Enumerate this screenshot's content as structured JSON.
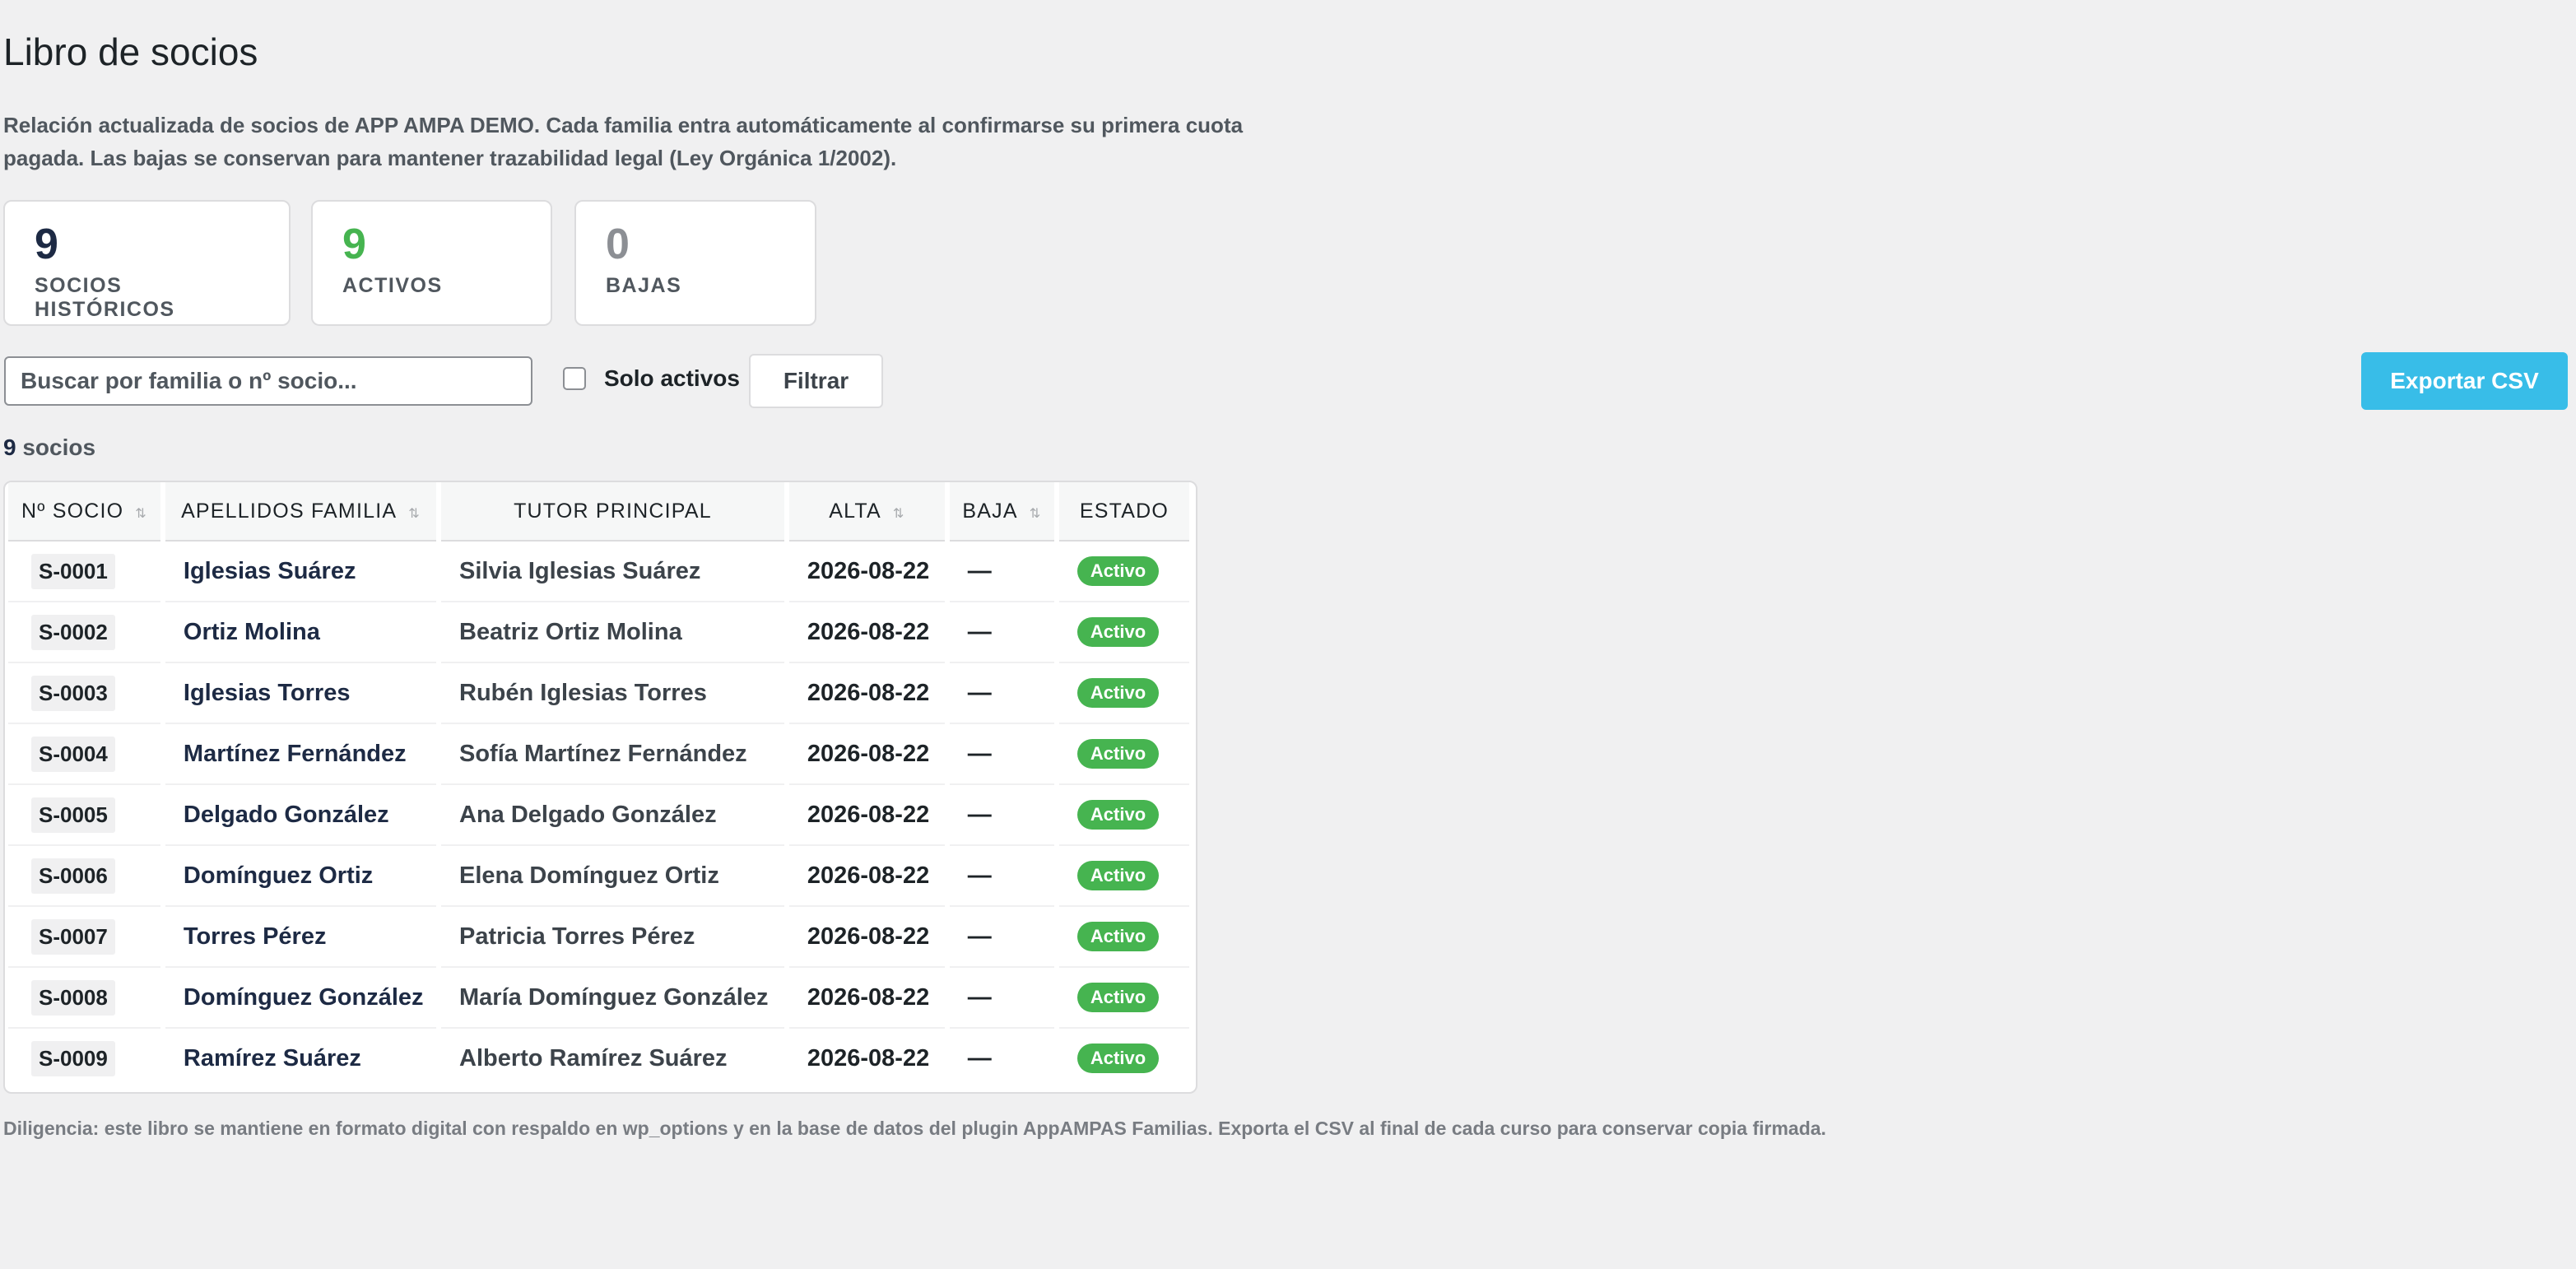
{
  "page": {
    "title": "Libro de socios",
    "intro": "Relación actualizada de socios de APP AMPA DEMO. Cada familia entra automáticamente al confirmarse su primera cuota pagada. Las bajas se conservan para mantener trazabilidad legal (Ley Orgánica 1/2002).",
    "footer": "Diligencia: este libro se mantiene en formato digital con respaldo en wp_options y en la base de datos del plugin AppAMPAS Familias. Exporta el CSV al final de cada curso para conservar copia firmada."
  },
  "stats": {
    "historicos": {
      "value": "9",
      "label": "SOCIOS HISTÓRICOS",
      "color": "#1d2a44"
    },
    "activos": {
      "value": "9",
      "label": "ACTIVOS",
      "color": "#46b450"
    },
    "bajas": {
      "value": "0",
      "label": "BAJAS",
      "color": "#8c8f94"
    }
  },
  "toolbar": {
    "search_placeholder": "Buscar por familia o nº socio...",
    "only_active_label": "Solo activos",
    "only_active_checked": false,
    "filter_label": "Filtrar",
    "export_label": "Exportar CSV",
    "export_color": "#38bde8"
  },
  "count": {
    "number": "9",
    "label": "socios"
  },
  "table": {
    "headers": {
      "socio": "Nº SOCIO",
      "familia": "APELLIDOS FAMILIA",
      "tutor": "TUTOR PRINCIPAL",
      "alta": "ALTA",
      "baja": "BAJA",
      "estado": "ESTADO"
    },
    "rows": [
      {
        "socio": "S-0001",
        "familia": "Iglesias Suárez",
        "tutor": "Silvia Iglesias Suárez",
        "alta": "2026-08-22",
        "baja": "—",
        "estado": "Activo"
      },
      {
        "socio": "S-0002",
        "familia": "Ortiz Molina",
        "tutor": "Beatriz Ortiz Molina",
        "alta": "2026-08-22",
        "baja": "—",
        "estado": "Activo"
      },
      {
        "socio": "S-0003",
        "familia": "Iglesias Torres",
        "tutor": "Rubén Iglesias Torres",
        "alta": "2026-08-22",
        "baja": "—",
        "estado": "Activo"
      },
      {
        "socio": "S-0004",
        "familia": "Martínez Fernández",
        "tutor": "Sofía Martínez Fernández",
        "alta": "2026-08-22",
        "baja": "—",
        "estado": "Activo"
      },
      {
        "socio": "S-0005",
        "familia": "Delgado González",
        "tutor": "Ana Delgado González",
        "alta": "2026-08-22",
        "baja": "—",
        "estado": "Activo"
      },
      {
        "socio": "S-0006",
        "familia": "Domínguez Ortiz",
        "tutor": "Elena Domínguez Ortiz",
        "alta": "2026-08-22",
        "baja": "—",
        "estado": "Activo"
      },
      {
        "socio": "S-0007",
        "familia": "Torres Pérez",
        "tutor": "Patricia Torres Pérez",
        "alta": "2026-08-22",
        "baja": "—",
        "estado": "Activo"
      },
      {
        "socio": "S-0008",
        "familia": "Domínguez González",
        "tutor": "María Domínguez González",
        "alta": "2026-08-22",
        "baja": "—",
        "estado": "Activo"
      },
      {
        "socio": "S-0009",
        "familia": "Ramírez Suárez",
        "tutor": "Alberto Ramírez Suárez",
        "alta": "2026-08-22",
        "baja": "—",
        "estado": "Activo"
      }
    ],
    "badge_color": "#46b450"
  }
}
